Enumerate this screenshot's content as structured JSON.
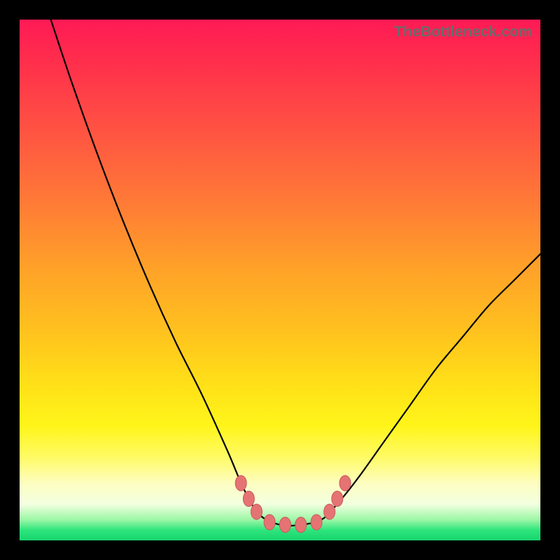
{
  "watermark": "TheBottleneck.com",
  "colors": {
    "frame_bg": "#000000",
    "curve": "#000000",
    "marker_fill": "#e57373",
    "marker_stroke": "#c85a5a",
    "gradient_top": "#ff1a55",
    "gradient_bottom": "#18d46e"
  },
  "chart_data": {
    "type": "line",
    "title": "",
    "xlabel": "",
    "ylabel": "",
    "xlim": [
      0,
      100
    ],
    "ylim": [
      0,
      100
    ],
    "grid": false,
    "legend": false,
    "annotations": [
      "TheBottleneck.com"
    ],
    "series": [
      {
        "name": "bottleneck-curve",
        "comment": "x in [0,100], y is bottleneck % (0 = optimal, 100 = worst). Curve valley ~x 45-60 at y≈3; left arm reaches y=100 at x≈6; right arm reaches y≈55 at x=100.",
        "x": [
          6,
          10,
          15,
          20,
          25,
          30,
          35,
          40,
          43,
          46,
          50,
          54,
          58,
          61,
          65,
          70,
          75,
          80,
          85,
          90,
          95,
          100
        ],
        "y": [
          100,
          88,
          74,
          61,
          49,
          38,
          28,
          17,
          10,
          5,
          3,
          3,
          4,
          7,
          12,
          19,
          26,
          33,
          39,
          45,
          50,
          55
        ]
      }
    ],
    "markers": {
      "comment": "pink oval markers near valley (left cluster at curve descent, right cluster at ascent, plus flat valley ones)",
      "points": [
        {
          "x": 42.5,
          "y": 11
        },
        {
          "x": 44.0,
          "y": 8
        },
        {
          "x": 45.5,
          "y": 5.5
        },
        {
          "x": 48.0,
          "y": 3.5
        },
        {
          "x": 51.0,
          "y": 3
        },
        {
          "x": 54.0,
          "y": 3
        },
        {
          "x": 57.0,
          "y": 3.5
        },
        {
          "x": 59.5,
          "y": 5.5
        },
        {
          "x": 61.0,
          "y": 8
        },
        {
          "x": 62.5,
          "y": 11
        }
      ]
    }
  }
}
